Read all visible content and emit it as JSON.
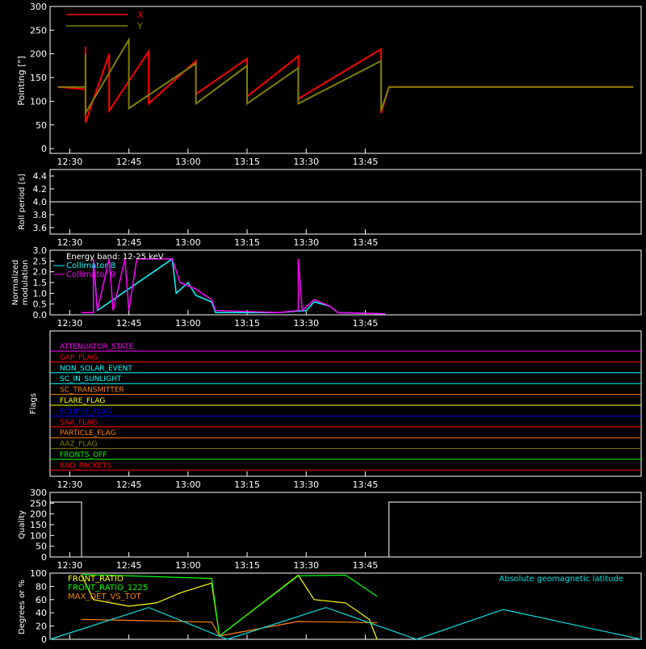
{
  "time_axis": {
    "ticks": [
      "12:30",
      "12:45",
      "13:00",
      "13:15",
      "13:30",
      "13:45"
    ],
    "range_minutes": [
      745,
      895
    ],
    "tick_minutes": [
      750,
      765,
      780,
      795,
      810,
      825
    ]
  },
  "colors": {
    "background": "#000000",
    "axis": "#ffffff",
    "x_series": "#ff0000",
    "y_series": "#808000",
    "collimator8": "#00ffff",
    "collimator9": "#ff00ff",
    "geomag": "#00e0e0",
    "front_ratio": "#ffff00",
    "front_ratio_1225": "#00ff00",
    "max_det": "#ff8000"
  },
  "panels": {
    "pointing": {
      "ylabel": "Pointing [\"]",
      "yticks": [
        "0",
        "50",
        "100",
        "150",
        "200",
        "250",
        "300"
      ],
      "ylim": [
        -10,
        300
      ],
      "legend": [
        {
          "label": "X",
          "color": "#ff0000"
        },
        {
          "label": "Y",
          "color": "#808000"
        }
      ]
    },
    "roll": {
      "ylabel": "Roll period [s]",
      "yticks": [
        "3.6",
        "3.8",
        "4.0",
        "4.2",
        "4.4"
      ],
      "ylim": [
        3.5,
        4.5
      ]
    },
    "modulation": {
      "ylabel_line1": "Normalized",
      "ylabel_line2": "modulation",
      "yticks": [
        "0.0",
        "0.5",
        "1.0",
        "1.5",
        "2.0",
        "2.5",
        "3.0"
      ],
      "ylim": [
        0,
        3
      ],
      "legend": [
        {
          "label": "Energy band: 12-25 keV",
          "color": "#ffffff"
        },
        {
          "label": "Collimator 8",
          "color": "#00ffff"
        },
        {
          "label": "Collimator 9",
          "color": "#ff00ff"
        }
      ]
    },
    "flags": {
      "ylabel": "Flags",
      "items": [
        {
          "label": "ATTENUATOR_STATE",
          "color": "#ff00ff"
        },
        {
          "label": "GAP_FLAG",
          "color": "#ff0000"
        },
        {
          "label": "NON_SOLAR_EVENT",
          "color": "#00ffff"
        },
        {
          "label": "SC_IN_SUNLIGHT",
          "color": "#00ffff"
        },
        {
          "label": "SC_TRANSMITTER",
          "color": "#ff8000"
        },
        {
          "label": "FLARE_FLAG",
          "color": "#ffff00"
        },
        {
          "label": "ECLIPSE_FLAG",
          "color": "#0000ff"
        },
        {
          "label": "SAA_FLAG",
          "color": "#ff0000"
        },
        {
          "label": "PARTICLE_FLAG",
          "color": "#ff8000"
        },
        {
          "label": "AAZ_FLAG",
          "color": "#808000"
        },
        {
          "label": "FRONTS_OFF",
          "color": "#00ff00"
        },
        {
          "label": "BAD_PACKETS",
          "color": "#ff0000"
        }
      ]
    },
    "quality": {
      "ylabel": "Quality",
      "yticks": [
        "0",
        "50",
        "100",
        "150",
        "200",
        "250",
        "300"
      ],
      "ylim": [
        0,
        300
      ]
    },
    "ratios": {
      "ylabel": "Degrees or %",
      "yticks": [
        "0",
        "20",
        "40",
        "60",
        "80",
        "100"
      ],
      "ylim": [
        0,
        100
      ],
      "legend": [
        {
          "label": "FRONT_RATIO",
          "color": "#ffff00"
        },
        {
          "label": "FRONT_RATIO_1225",
          "color": "#00ff00"
        },
        {
          "label": "MAX_DET_VS_TOT",
          "color": "#ff8000"
        }
      ],
      "annotation": "Absolute geomagnetic latitude"
    }
  },
  "chart_data": [
    {
      "type": "area",
      "ylabel": "Pointing [\"]",
      "ylim": [
        -10,
        300
      ],
      "series": [
        {
          "name": "X",
          "color": "#ff0000",
          "points": [
            [
              747,
              130
            ],
            [
              754,
              125
            ],
            [
              754,
              215
            ],
            [
              754,
              55
            ],
            [
              760,
              200
            ],
            [
              760,
              80
            ],
            [
              770,
              205
            ],
            [
              770,
              95
            ],
            [
              782,
              185
            ],
            [
              782,
              115
            ],
            [
              795,
              190
            ],
            [
              795,
              110
            ],
            [
              808,
              195
            ],
            [
              808,
              105
            ],
            [
              829,
              210
            ],
            [
              829,
              75
            ],
            [
              831,
              130
            ],
            [
              893,
              130
            ]
          ]
        },
        {
          "name": "Y",
          "color": "#808000",
          "points": [
            [
              747,
              130
            ],
            [
              754,
              130
            ],
            [
              754,
              200
            ],
            [
              754,
              75
            ],
            [
              765,
              230
            ],
            [
              765,
              85
            ],
            [
              782,
              180
            ],
            [
              782,
              95
            ],
            [
              795,
              175
            ],
            [
              795,
              95
            ],
            [
              808,
              170
            ],
            [
              808,
              95
            ],
            [
              829,
              185
            ],
            [
              829,
              80
            ],
            [
              831,
              130
            ],
            [
              893,
              130
            ]
          ]
        }
      ]
    },
    {
      "type": "line",
      "ylabel": "Roll period [s]",
      "ylim": [
        3.5,
        4.5
      ],
      "x": [
        745,
        895
      ],
      "y": [
        4.0,
        4.0
      ]
    },
    {
      "type": "line",
      "ylabel": "Normalized modulation",
      "ylim": [
        0,
        3
      ],
      "series": [
        {
          "name": "Collimator 8",
          "color": "#00ffff",
          "points": [
            [
              753,
              0.1
            ],
            [
              756,
              0.1
            ],
            [
              756,
              2.6
            ],
            [
              757,
              0.2
            ],
            [
              776,
              2.6
            ],
            [
              777,
              1.0
            ],
            [
              780,
              1.5
            ],
            [
              782,
              0.9
            ],
            [
              786,
              0.6
            ],
            [
              787,
              0.1
            ],
            [
              803,
              0.1
            ],
            [
              810,
              0.2
            ],
            [
              812,
              0.6
            ],
            [
              816,
              0.4
            ],
            [
              818,
              0.1
            ],
            [
              830,
              0.05
            ]
          ]
        },
        {
          "name": "Collimator 9",
          "color": "#ff00ff",
          "points": [
            [
              753,
              0.1
            ],
            [
              756,
              0.1
            ],
            [
              756,
              2.6
            ],
            [
              757,
              0.2
            ],
            [
              760,
              2.6
            ],
            [
              761,
              0.2
            ],
            [
              764,
              2.6
            ],
            [
              765,
              0.2
            ],
            [
              767,
              2.6
            ],
            [
              771,
              2.6
            ],
            [
              776,
              2.6
            ],
            [
              778,
              1.5
            ],
            [
              782,
              1.2
            ],
            [
              786,
              0.7
            ],
            [
              787,
              0.2
            ],
            [
              803,
              0.1
            ],
            [
              808,
              0.2
            ],
            [
              808,
              2.6
            ],
            [
              809,
              0.2
            ],
            [
              812,
              0.7
            ],
            [
              816,
              0.4
            ],
            [
              818,
              0.1
            ],
            [
              830,
              0.05
            ]
          ]
        }
      ]
    },
    {
      "type": "line",
      "ylabel": "Quality",
      "ylim": [
        0,
        300
      ],
      "x": [
        745,
        753,
        753,
        831,
        831,
        895
      ],
      "y": [
        255,
        255,
        0,
        0,
        255,
        255
      ]
    },
    {
      "type": "line",
      "ylabel": "Degrees or %",
      "ylim": [
        0,
        100
      ],
      "series": [
        {
          "name": "FRONT_RATIO",
          "color": "#ffff00",
          "points": [
            [
              753,
              97
            ],
            [
              756,
              60
            ],
            [
              765,
              50
            ],
            [
              772,
              55
            ],
            [
              778,
              70
            ],
            [
              786,
              85
            ],
            [
              788,
              5
            ],
            [
              808,
              97
            ],
            [
              812,
              60
            ],
            [
              820,
              55
            ],
            [
              826,
              30
            ],
            [
              828,
              0
            ]
          ]
        },
        {
          "name": "FRONT_RATIO_1225",
          "color": "#00ff00",
          "points": [
            [
              753,
              98
            ],
            [
              770,
              95
            ],
            [
              786,
              92
            ],
            [
              788,
              5
            ],
            [
              808,
              96
            ],
            [
              820,
              97
            ],
            [
              828,
              65
            ]
          ]
        },
        {
          "name": "MAX_DET_VS_TOT",
          "color": "#ff8000",
          "points": [
            [
              753,
              30
            ],
            [
              770,
              28
            ],
            [
              786,
              26
            ],
            [
              788,
              5
            ],
            [
              808,
              27
            ],
            [
              820,
              26
            ],
            [
              828,
              25
            ]
          ]
        },
        {
          "name": "Absolute geomagnetic latitude",
          "color": "#00e0e0",
          "points": [
            [
              745,
              0
            ],
            [
              770,
              48
            ],
            [
              790,
              0
            ],
            [
              815,
              48
            ],
            [
              838,
              0
            ],
            [
              860,
              45
            ],
            [
              895,
              0
            ]
          ]
        }
      ]
    }
  ]
}
